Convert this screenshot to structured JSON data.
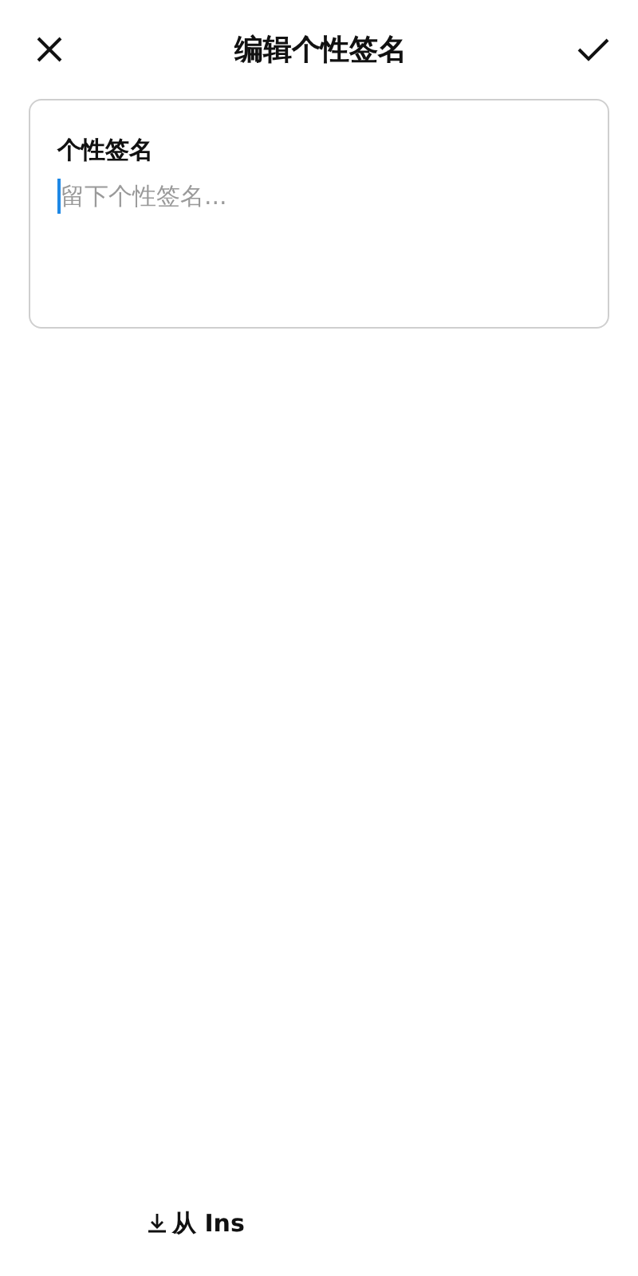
{
  "header": {
    "title": "编辑个性签名"
  },
  "field": {
    "label": "个性签名",
    "placeholder": "留下个性签名..."
  },
  "import_link": {
    "label": "从 Ins"
  }
}
